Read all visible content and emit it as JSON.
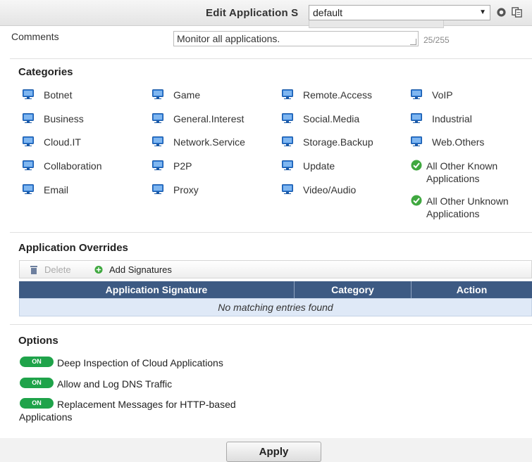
{
  "header": {
    "title": "Edit Application S",
    "profile_value": "default"
  },
  "comments": {
    "label": "Comments",
    "value": "Monitor all applications.",
    "count": "25/255"
  },
  "categories": {
    "title": "Categories",
    "items": [
      {
        "label": "Botnet",
        "icon": "monitor-icon"
      },
      {
        "label": "Business",
        "icon": "monitor-icon"
      },
      {
        "label": "Cloud.IT",
        "icon": "monitor-icon"
      },
      {
        "label": "Collaboration",
        "icon": "monitor-icon"
      },
      {
        "label": "Email",
        "icon": "monitor-icon"
      },
      {
        "label": "Game",
        "icon": "monitor-icon"
      },
      {
        "label": "General.Interest",
        "icon": "monitor-icon"
      },
      {
        "label": "Network.Service",
        "icon": "monitor-icon"
      },
      {
        "label": "P2P",
        "icon": "monitor-icon"
      },
      {
        "label": "Proxy",
        "icon": "monitor-icon"
      },
      {
        "label": "Remote.Access",
        "icon": "monitor-icon"
      },
      {
        "label": "Social.Media",
        "icon": "monitor-icon"
      },
      {
        "label": "Storage.Backup",
        "icon": "monitor-icon"
      },
      {
        "label": "Update",
        "icon": "monitor-icon"
      },
      {
        "label": "Video/Audio",
        "icon": "monitor-icon"
      },
      {
        "label": "VoIP",
        "icon": "monitor-icon"
      },
      {
        "label": "Industrial",
        "icon": "monitor-icon"
      },
      {
        "label": "Web.Others",
        "icon": "monitor-icon"
      },
      {
        "label": "All Other Known Applications",
        "icon": "check-icon"
      },
      {
        "label": "All Other Unknown Applications",
        "icon": "check-icon"
      }
    ]
  },
  "overrides": {
    "title": "Application Overrides",
    "delete_label": "Delete",
    "add_label": "Add Signatures",
    "columns": [
      "Application Signature",
      "Category",
      "Action"
    ],
    "empty_text": "No matching entries found"
  },
  "options": {
    "title": "Options",
    "toggle_label": "ON",
    "items": [
      {
        "label": "Deep Inspection of Cloud Applications",
        "state": "ON"
      },
      {
        "label": "Allow and Log DNS Traffic",
        "state": "ON"
      },
      {
        "label": "Replacement Messages for HTTP-based",
        "label_cont": "Applications",
        "state": "ON"
      }
    ]
  },
  "footer": {
    "apply_label": "Apply"
  },
  "colors": {
    "accent": "#3d5a83",
    "toggle_on": "#1fa34a",
    "table_empty_bg": "#dfe9f7"
  }
}
